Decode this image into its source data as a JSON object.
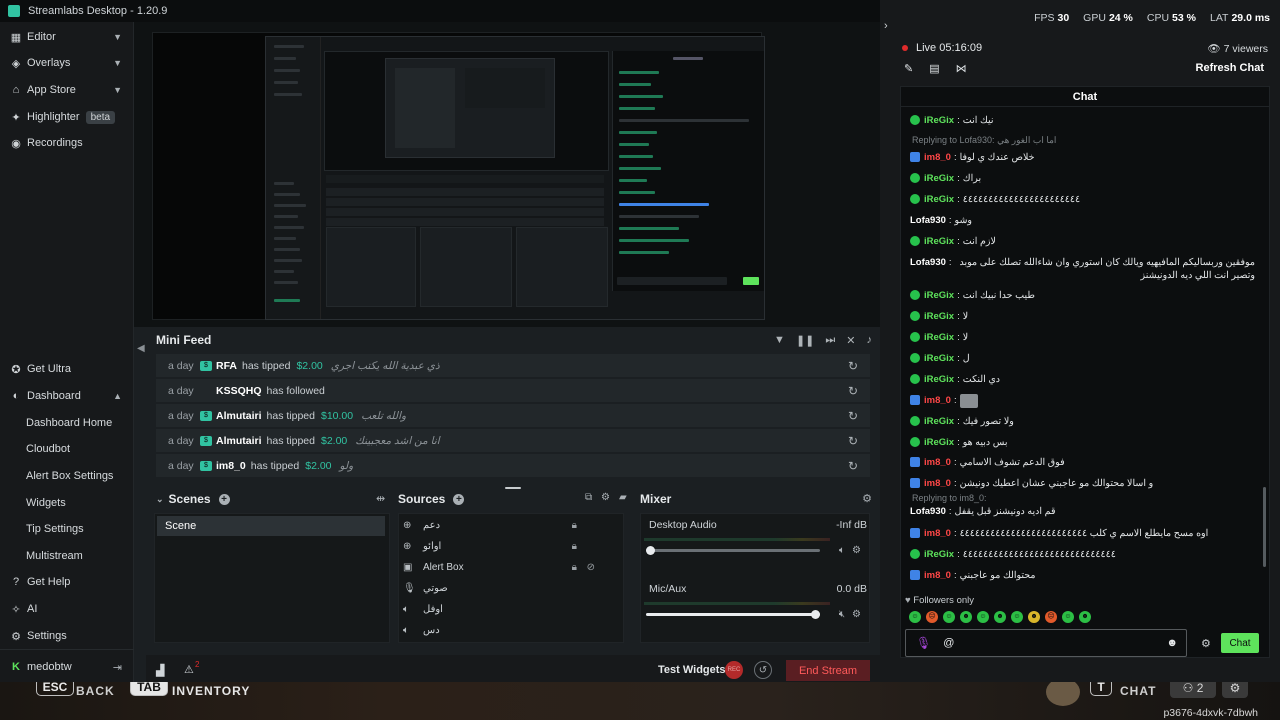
{
  "titlebar": {
    "title": "Streamlabs Desktop - 1.20.9"
  },
  "sidebar": {
    "top_items": [
      {
        "label": "Editor",
        "icon": "editor-icon"
      },
      {
        "label": "Overlays",
        "icon": "overlays-icon"
      },
      {
        "label": "App Store",
        "icon": "app-store-icon"
      },
      {
        "label": "Highlighter",
        "icon": "highlighter-icon",
        "badge": "beta"
      },
      {
        "label": "Recordings",
        "icon": "recordings-icon"
      }
    ],
    "bottom_items": [
      {
        "label": "Get Ultra"
      },
      {
        "label": "Dashboard"
      },
      {
        "label": "Dashboard Home"
      },
      {
        "label": "Cloudbot"
      },
      {
        "label": "Alert Box Settings"
      },
      {
        "label": "Widgets"
      },
      {
        "label": "Tip Settings"
      },
      {
        "label": "Multistream"
      },
      {
        "label": "Get Help"
      },
      {
        "label": "AI"
      },
      {
        "label": "Settings"
      }
    ],
    "user": {
      "name": "medobtw"
    }
  },
  "mini_feed": {
    "title": "Mini Feed",
    "rows": [
      {
        "time": "a day",
        "user": "RFA",
        "action": "has tipped",
        "amount": "$2.00",
        "message": "ذي عبدية الله يكتب اجري"
      },
      {
        "time": "a day",
        "user": "KSSQHQ",
        "action": "has followed",
        "amount": "",
        "message": ""
      },
      {
        "time": "a day",
        "user": "Almutairi",
        "action": "has tipped",
        "amount": "$10.00",
        "message": "والله تلعب"
      },
      {
        "time": "a day",
        "user": "Almutairi",
        "action": "has tipped",
        "amount": "$2.00",
        "message": "انا من اشد معجبينك"
      },
      {
        "time": "a day",
        "user": "im8_0",
        "action": "has tipped",
        "amount": "$2.00",
        "message": "ولو"
      }
    ]
  },
  "scenes": {
    "title": "Scenes",
    "items": [
      "Scene"
    ]
  },
  "sources": {
    "title": "Sources",
    "items": [
      {
        "label": "دعم",
        "icon": "globe-icon"
      },
      {
        "label": "اوائو",
        "icon": "globe-icon"
      },
      {
        "label": "Alert Box",
        "icon": "alert-box-icon"
      },
      {
        "label": "صوتي",
        "icon": "mic-icon"
      },
      {
        "label": "اوفل",
        "icon": "speaker-icon"
      },
      {
        "label": "دس",
        "icon": "speaker-icon"
      }
    ]
  },
  "mixer": {
    "title": "Mixer",
    "channels": [
      {
        "name": "Desktop Audio",
        "db": "-Inf dB",
        "volume": 0.0
      },
      {
        "name": "Mic/Aux",
        "db": "0.0 dB",
        "volume": 1.0
      }
    ]
  },
  "bottom_bar": {
    "test_widgets": "Test Widgets",
    "rec": "REC",
    "end_stream": "End Stream",
    "alerts_count": "2"
  },
  "stats": {
    "fps_label": "FPS",
    "fps": "30",
    "gpu_label": "GPU",
    "gpu": "24 %",
    "cpu_label": "CPU",
    "cpu": "53 %",
    "lat_label": "LAT",
    "lat": "29.0 ms"
  },
  "live": {
    "label": "Live",
    "time": "05:16:09",
    "viewers": "7 viewers",
    "refresh": "Refresh Chat"
  },
  "chat": {
    "title": "Chat",
    "messages": [
      {
        "user": "iReGix",
        "color": "green",
        "text": "نيك انت"
      },
      {
        "reply_to": "Replying to Lofa930: اما اب الغور هي"
      },
      {
        "user": "im8_0",
        "color": "red",
        "text": "خلاص عندك ي لوفا"
      },
      {
        "user": "iReGix",
        "color": "green",
        "text": "براك"
      },
      {
        "user": "iReGix",
        "color": "green",
        "text": "٤٤٤٤٤٤٤٤٤٤٤٤٤٤٤٤٤٤٤٤٤٤٤"
      },
      {
        "user": "Lofa930",
        "color": "white",
        "text": "وشو"
      },
      {
        "user": "iReGix",
        "color": "green",
        "text": "لازم انت"
      },
      {
        "user": "Lofa930",
        "color": "white",
        "text": "موفقين وربساليكم المافيهيه ويالك كان استوري وان شاءالله تصلك على موبد وتصير انت اللي ديه الدونيشنز"
      },
      {
        "user": "iReGix",
        "color": "green",
        "text": "طيب حدا نبيك انت"
      },
      {
        "user": "iReGix",
        "color": "green",
        "text": "لا"
      },
      {
        "user": "iReGix",
        "color": "green",
        "text": "لا"
      },
      {
        "user": "iReGix",
        "color": "green",
        "text": "ل"
      },
      {
        "user": "iReGix",
        "color": "green",
        "text": "دي النكت"
      },
      {
        "user": "im8_0",
        "color": "red",
        "text": ""
      },
      {
        "user": "iReGix",
        "color": "green",
        "text": "ولا تصور فيك"
      },
      {
        "user": "iReGix",
        "color": "green",
        "text": "بس دبيه هو"
      },
      {
        "user": "im8_0",
        "color": "red",
        "text": "فوق الدعم تشوف الاسامي"
      },
      {
        "user": "im8_0",
        "color": "red",
        "text": "و اسالا محتوالك مو عاجبني عشان اعطيك دونيشن"
      },
      {
        "reply_to": "Replying to im8_0:"
      },
      {
        "user": "Lofa930",
        "color": "white",
        "text": "قم اديه دونيشنز قبل يقفل"
      },
      {
        "user": "im8_0",
        "color": "red",
        "text": "اوه مسح مايطلع الاسم ي كلب ٤٤٤٤٤٤٤٤٤٤٤٤٤٤٤٤٤٤٤٤٤٤٤٤٤"
      },
      {
        "user": "iReGix",
        "color": "green",
        "text": "٤٤٤٤٤٤٤٤٤٤٤٤٤٤٤٤٤٤٤٤٤٤٤٤٤٤٤٤٤٤"
      },
      {
        "user": "im8_0",
        "color": "red",
        "text": "محتوالك مو عاجبني"
      }
    ],
    "followers_only": "Followers only",
    "input_value": "@",
    "send_label": "Chat"
  },
  "game_overlay": {
    "esc": "ESC",
    "back": "BACK",
    "tab": "TAB",
    "inventory": "INVENTORY",
    "t_key": "T",
    "chat": "CHAT",
    "party_count": "2",
    "session_id": "p3676-4dxvk-7dbwh"
  }
}
